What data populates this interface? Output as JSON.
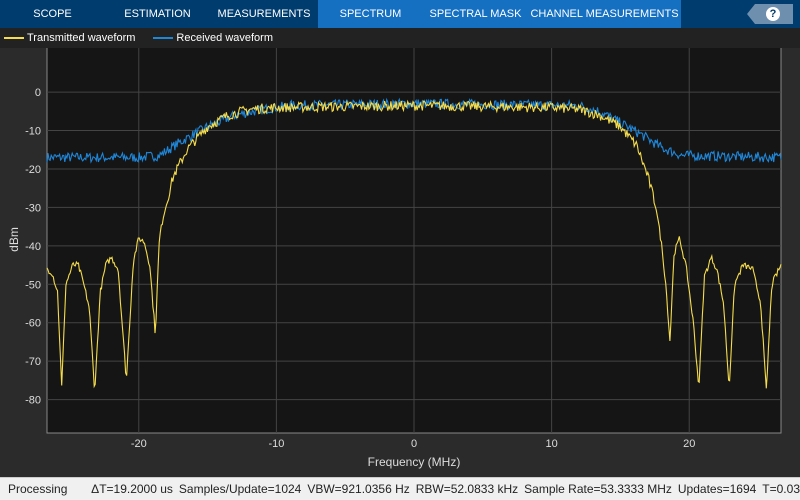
{
  "tabs": [
    {
      "label": "SCOPE",
      "ctx": false
    },
    {
      "label": "ESTIMATION",
      "ctx": false
    },
    {
      "label": "MEASUREMENTS",
      "ctx": false
    },
    {
      "label": "SPECTRUM",
      "ctx": true
    },
    {
      "label": "SPECTRAL MASK",
      "ctx": true
    },
    {
      "label": "CHANNEL MEASUREMENTS",
      "ctx": true
    }
  ],
  "help_label": "?",
  "colors": {
    "tx": "#f5dc4c",
    "rx": "#1f86d8",
    "axes_bg": "#151515",
    "grid": "#444444",
    "toolstrip": "#003c6e",
    "context_tab": "#1570c2"
  },
  "status": {
    "state": "Processing",
    "dt": "ΔT=19.2000 us",
    "samples": "Samples/Update=1024",
    "vbw": "VBW=921.0356 Hz",
    "rbw": "RBW=52.0833 kHz",
    "sample_rate": "Sample Rate=53.3333 MHz",
    "updates": "Updates=1694",
    "t": "T=0.03"
  },
  "chart_data": {
    "type": "line",
    "xlabel": "Frequency (MHz)",
    "ylabel": "dBm",
    "xlim": [
      -26.67,
      26.67
    ],
    "ylim": [
      -88.7,
      12
    ],
    "xticks": [
      -20,
      -10,
      0,
      10,
      20
    ],
    "yticks": [
      0,
      -10,
      -20,
      -30,
      -40,
      -50,
      -60,
      -70,
      -80
    ],
    "grid": true,
    "legend": "top-left",
    "series": [
      {
        "name": "Transmitted waveform",
        "color": "#f5dc4c",
        "x": [
          -26.67,
          -26.3,
          -25.9,
          -25.6,
          -25.3,
          -24.8,
          -24.4,
          -24,
          -23.6,
          -23.2,
          -22.8,
          -22.4,
          -22,
          -21.5,
          -20.9,
          -20.4,
          -20,
          -19.6,
          -19.2,
          -18.8,
          -18.5,
          -18.2,
          -17.5,
          -16.5,
          -15,
          -13.5,
          -12,
          -10,
          0,
          10,
          12,
          13.5,
          15,
          16.2,
          17,
          17.6,
          18,
          18.3,
          18.6,
          18.9,
          19.3,
          19.8,
          20.3,
          20.7,
          21.1,
          21.6,
          22,
          22.5,
          22.9,
          23.3,
          23.9,
          24.6,
          25.2,
          25.6,
          26,
          26.67
        ],
        "y": [
          -46,
          -47,
          -52,
          -77,
          -50,
          -45,
          -45,
          -50,
          -56,
          -78,
          -52,
          -45,
          -43,
          -46,
          -75,
          -44,
          -38,
          -39,
          -45,
          -63,
          -38,
          -32,
          -22,
          -15,
          -9,
          -6,
          -4.5,
          -4,
          -3.5,
          -4,
          -4.5,
          -6,
          -9,
          -14,
          -22,
          -30,
          -40,
          -50,
          -65,
          -42,
          -38,
          -46,
          -60,
          -77,
          -48,
          -43,
          -46,
          -55,
          -77,
          -50,
          -45,
          -46,
          -55,
          -78,
          -50,
          -45
        ]
      },
      {
        "name": "Received waveform",
        "color": "#1f86d8",
        "x": [
          -26.67,
          -20,
          -18.5,
          -17,
          -15,
          -13,
          -11,
          -9,
          0,
          12,
          13.5,
          15,
          16.5,
          18,
          19.5,
          26.67
        ],
        "y": [
          -17,
          -17,
          -16.5,
          -13,
          -9,
          -6,
          -4.5,
          -3.5,
          -3,
          -3.5,
          -5,
          -8,
          -11,
          -14.5,
          -16.5,
          -17
        ]
      }
    ]
  }
}
